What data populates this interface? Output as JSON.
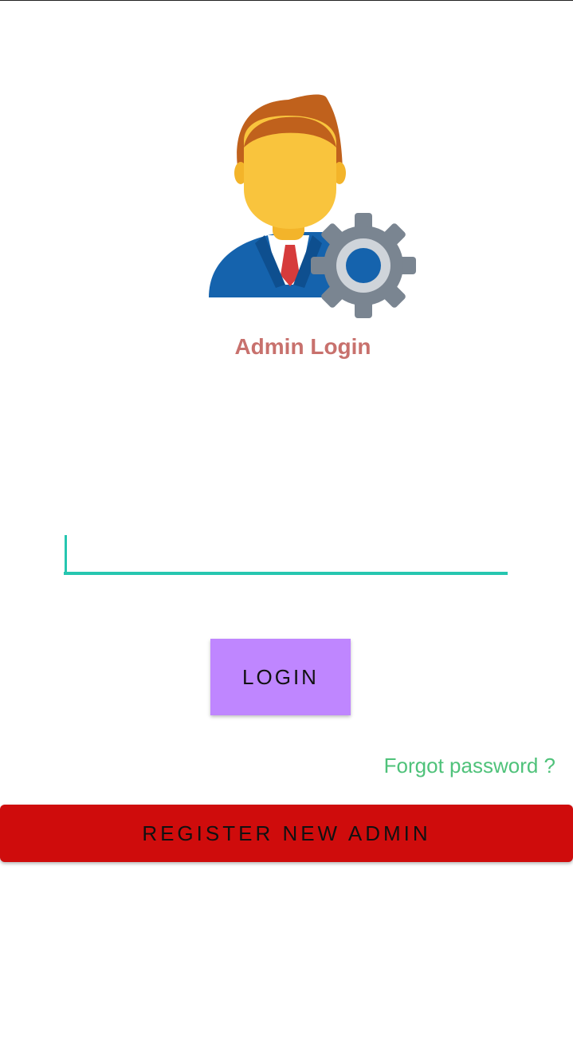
{
  "header": {
    "title": "Admin Login"
  },
  "avatar": {
    "icon": "admin-settings-icon"
  },
  "form": {
    "input_value": "",
    "input_placeholder": ""
  },
  "actions": {
    "login_label": "LOGIN",
    "forgot_label": "Forgot password ?",
    "register_label": "REGISTER NEW ADMIN"
  },
  "colors": {
    "title": "#c8716d",
    "input_underline": "#26c6b0",
    "login_button": "#bf86ff",
    "forgot_link": "#4fc27a",
    "register_button": "#cf0c0c"
  }
}
